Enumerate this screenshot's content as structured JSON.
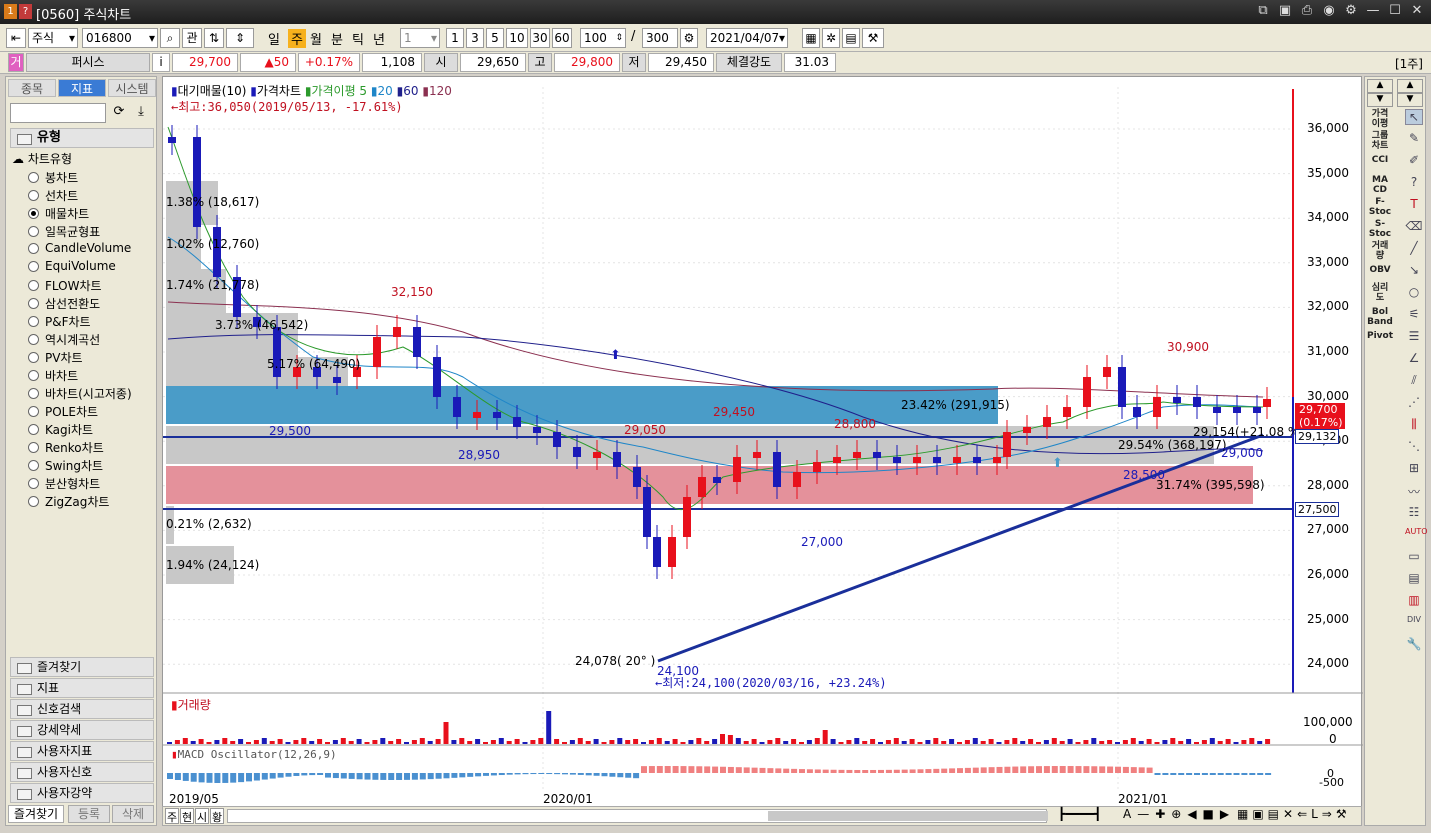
{
  "window": {
    "badge1": "1",
    "badge2": "?",
    "title": "[0560] 주식차트"
  },
  "toolbar": {
    "market": "주식",
    "code": "016800",
    "btn_kwan": "관",
    "periods": [
      "일",
      "주",
      "월",
      "분",
      "틱",
      "년"
    ],
    "active_period": "주",
    "interval_value": "1",
    "interval_buttons": [
      "1",
      "3",
      "5",
      "10",
      "30",
      "60"
    ],
    "count": "100",
    "total": "300",
    "slash": "/",
    "date": "2021/04/07"
  },
  "quote": {
    "tag": "거",
    "name": "퍼시스",
    "info": "i",
    "price": "29,700",
    "change": "▲50",
    "rate": "+0.17%",
    "volume": "1,108",
    "open_label": "시",
    "open": "29,650",
    "high_label": "고",
    "high": "29,800",
    "low_label": "저",
    "low": "29,450",
    "strength_label": "체결강도",
    "strength": "31.03",
    "unit": "[1주]"
  },
  "left_panel": {
    "tabs": [
      "종목",
      "지표",
      "시스템"
    ],
    "active_tab": "지표",
    "group_title": "유형",
    "tree_title": "차트유형",
    "chart_types": [
      "봉차트",
      "선차트",
      "매물차트",
      "일목균형표",
      "CandleVolume",
      "EquiVolume",
      "FLOW차트",
      "삼선전환도",
      "P&F차트",
      "역시계곡선",
      "PV차트",
      "바차트",
      "바차트(시고저종)",
      "POLE차트",
      "Kagi차트",
      "Renko차트",
      "Swing차트",
      "분산형차트",
      "ZigZag차트"
    ],
    "selected_type": "매물차트",
    "folders": [
      "즐겨찾기",
      "지표",
      "신호검색",
      "강세약세",
      "사용자지표",
      "사용자신호",
      "사용자강약"
    ],
    "bottom_tabs": [
      "즐겨찾기",
      "등록",
      "삭제"
    ]
  },
  "chart": {
    "legend_main": "대기매물(10)",
    "legend_price": "가격차트",
    "legend_ma": "가격이평 5",
    "legend_ma20": "20",
    "legend_ma60": "60",
    "legend_ma120": "120",
    "max_note": "←최고:36,050(2019/05/13, -17.61%)",
    "min_note": "←최저:24,100(2020/03/16, +23.24%)",
    "volume_title": "거래량",
    "macd_title": "MACD Oscillator(12,26,9)",
    "x_labels": [
      "2019/05",
      "2020/01",
      "2021/01"
    ],
    "y_labels": [
      "36,000",
      "35,000",
      "34,000",
      "33,000",
      "32,000",
      "31,000",
      "30,000",
      "29,000",
      "28,000",
      "27,000",
      "26,000",
      "25,000",
      "24,000"
    ],
    "vol_labels": [
      "100,000",
      "0"
    ],
    "macd_labels": [
      "0",
      "-500"
    ],
    "price_tag": "29,700",
    "price_tag_rate": "(0.17%)",
    "trend_tag": "29,132",
    "line_tag": "27,500",
    "annotations": {
      "a1": "1.38% (18,617)",
      "a2": "1.02% (12,760)",
      "a3": "1.74% (21,778)",
      "a4": "3.73% (46,542)",
      "a5": "5.17% (64,490)",
      "a6": "23.42% (291,915)",
      "a7": "29.54% (368,197)",
      "a8": "31.74% (395,598)",
      "a9": "0.21% (2,632)",
      "a10": "1.94% (24,124)",
      "trend": "24,078( 20° )",
      "trend_end": "29,154(+21.08 %)"
    },
    "price_labels": {
      "p1": "32,150",
      "p2": "29,500",
      "p3": "28,950",
      "p4": "29,450",
      "p5": "29,050",
      "p6": "28,800",
      "p7": "27,000",
      "p8": "24,100",
      "p9": "30,900",
      "p10": "28,500",
      "p11": "29,000"
    }
  },
  "chart_data": {
    "type": "candlestick",
    "ylim": [
      23700,
      36600
    ],
    "volume_profile": [
      {
        "price": 35000,
        "pct": 1.38,
        "volume": 18617
      },
      {
        "price": 34000,
        "pct": 1.02,
        "volume": 12760
      },
      {
        "price": 33000,
        "pct": 1.74,
        "volume": 21778
      },
      {
        "price": 32000,
        "pct": 3.73,
        "volume": 46542
      },
      {
        "price": 31000,
        "pct": 5.17,
        "volume": 64490
      },
      {
        "price": 30000,
        "pct": 23.42,
        "volume": 291915
      },
      {
        "price": 29000,
        "pct": 29.54,
        "volume": 368197
      },
      {
        "price": 28000,
        "pct": 31.74,
        "volume": 395598
      },
      {
        "price": 27000,
        "pct": 0.21,
        "volume": 2632
      },
      {
        "price": 26000,
        "pct": 1.94,
        "volume": 24124
      }
    ],
    "high": 36050,
    "low": 24100
  },
  "right_tools": {
    "labels": [
      "가격\n이평",
      "그룹\n차트",
      "CCI",
      "MA\nCD",
      "F-\nStoc",
      "S-\nStoc",
      "거래\n량",
      "OBV",
      "심리\n도",
      "Bol\nBand",
      "Pivot"
    ]
  },
  "bottom": {
    "buttons": [
      "주",
      "현",
      "시",
      "황"
    ]
  },
  "colors": {
    "up": "#e8101c",
    "down": "#1a1ab8",
    "accent": "#3a7bd5"
  }
}
